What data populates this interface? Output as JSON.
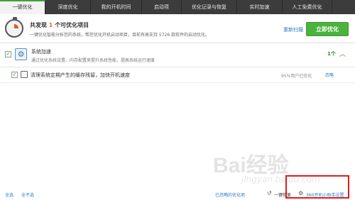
{
  "tabs": [
    {
      "label": "一键优化"
    },
    {
      "label": "深度优化"
    },
    {
      "label": "我的开机时间"
    },
    {
      "label": "启动项"
    },
    {
      "label": "优化记录与恢复"
    },
    {
      "label": "实时加速"
    },
    {
      "label": "人工免费优化"
    }
  ],
  "header": {
    "title_prefix": "共发现",
    "title_count": "1",
    "title_suffix": "个可优化项目",
    "subtitle": "一键优化智能分析您的系统，帮您优化开机启动项目，目前有高支持 5726 款软件的启动优化。",
    "rescan_label": "重新扫描",
    "optimize_label": "立即优化"
  },
  "group": {
    "title": "系统加速",
    "description": "通过优化系统设置、内存配置来提升系统性能，提高系统运行速度",
    "count": "1个"
  },
  "items": [
    {
      "label": "清理系统定期产生的缓存残留，加快开机速度",
      "stat": "95%用户已优化",
      "action": "忽略"
    }
  ],
  "footer": {
    "select_all": "全选",
    "select_none": "全不选",
    "ignored_items": "已忽略的优化项",
    "one_click_restore": "一键恢复",
    "settings_label": "360开机小助手设置"
  },
  "watermark": {
    "logo": "Bai经验",
    "url": "jingyan.baidu.com"
  },
  "colors": {
    "accent_green": "#4bb33d",
    "link_blue": "#2b7bc4",
    "highlight_orange": "#e86a17",
    "annotation_red": "#e11b1b"
  }
}
